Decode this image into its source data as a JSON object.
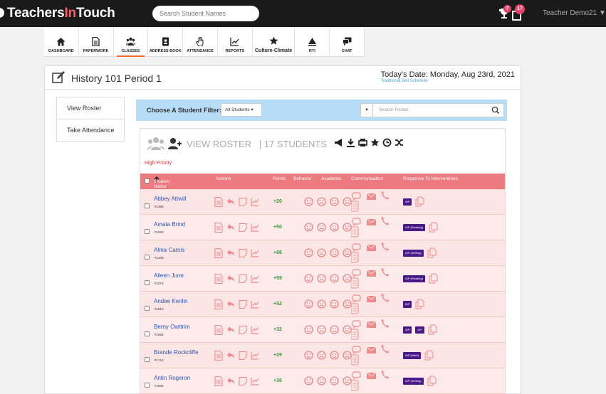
{
  "app": {
    "logo_part1": "Teachers",
    "logo_part2": "In",
    "logo_part3": "Touch",
    "search_placeholder": "Search Student Names",
    "trophy_badge": "7",
    "notif_badge": "17",
    "user": "Teacher Demo21"
  },
  "nav": [
    {
      "label": "DASHBOARD",
      "icon": "home-icon"
    },
    {
      "label": "PAPERWORK",
      "icon": "document-icon"
    },
    {
      "label": "CLASSES",
      "icon": "group-icon",
      "active": true
    },
    {
      "label": "ADDRESS BOOK",
      "icon": "address-book-icon"
    },
    {
      "label": "ATTENDANCE",
      "icon": "hand-icon"
    },
    {
      "label": "REPORTS",
      "icon": "chart-icon"
    },
    {
      "label": "Culture-Climate",
      "icon": "star-icon"
    },
    {
      "label": "RTI",
      "icon": "triangle-icon"
    },
    {
      "label": "CHAT",
      "icon": "chat-icon"
    }
  ],
  "page": {
    "title": "History 101 Period 1",
    "date": "Today's Date: Monday, Aug 23rd, 2021",
    "schedule": "Traditional Bell Schedule"
  },
  "side": {
    "view_roster": "View Roster",
    "take_attendance": "Take Attendance"
  },
  "filter": {
    "label": "Choose A Student Filter:",
    "selected": "All Students",
    "search_placeholder": "Search Roster.."
  },
  "roster": {
    "title": "VIEW ROSTER",
    "count": "| 17 STUDENTS",
    "priority": "High Priority"
  },
  "columns": {
    "name": "Student Name",
    "actions": "Actions",
    "points": "Points",
    "behavior": "Behavior",
    "academic": "Academic",
    "communication": "Communication",
    "rti": "Response To Interventions"
  },
  "students": [
    {
      "name": "Abbey Attwill",
      "id": "#1359",
      "points": "+20",
      "rti": [
        "AIP"
      ]
    },
    {
      "name": "Amata Brind",
      "id": "#1923",
      "points": "+50",
      "rti": [
        "AIP (Reading)"
      ]
    },
    {
      "name": "Alma Camis",
      "id": "#1235",
      "points": "+66",
      "rti": [
        "AIP (Writing)"
      ]
    },
    {
      "name": "Alleen June",
      "id": "#1073",
      "points": "+59",
      "rti": [
        "AIP (Reading)"
      ]
    },
    {
      "name": "Andee Kenlin",
      "id": "#1810",
      "points": "+52",
      "rti": [
        "BIP"
      ]
    },
    {
      "name": "Berny Owttrim",
      "id": "#1683",
      "points": "+32",
      "rti": [
        "AIP",
        "AIP"
      ]
    },
    {
      "name": "Brande Rockcliffe",
      "id": "#1713",
      "points": "+29",
      "rti": [
        "AIP (Math)"
      ]
    },
    {
      "name": "Antin Rogeron",
      "id": "#1833",
      "points": "+36",
      "rti": [
        "AIP (Writing)"
      ]
    }
  ]
}
